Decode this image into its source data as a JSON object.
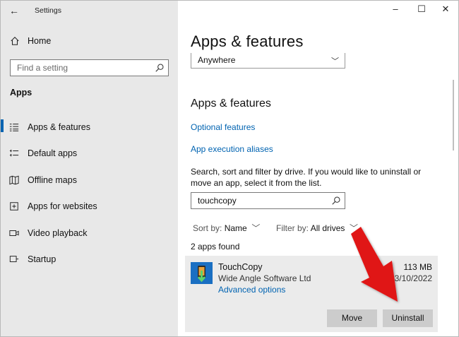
{
  "window": {
    "title": "Settings"
  },
  "sidebar": {
    "home_label": "Home",
    "search_placeholder": "Find a setting",
    "section_label": "Apps",
    "items": [
      {
        "label": "Apps & features",
        "icon": "apps-features-icon",
        "active": true
      },
      {
        "label": "Default apps",
        "icon": "default-apps-icon"
      },
      {
        "label": "Offline maps",
        "icon": "offline-maps-icon"
      },
      {
        "label": "Apps for websites",
        "icon": "apps-for-websites-icon"
      },
      {
        "label": "Video playback",
        "icon": "video-playback-icon"
      },
      {
        "label": "Startup",
        "icon": "startup-icon"
      }
    ]
  },
  "main": {
    "page_title": "Apps & features",
    "install_source_value": "Anywhere",
    "section_title": "Apps & features",
    "optional_features_link": "Optional features",
    "execution_aliases_link": "App execution aliases",
    "description": "Search, sort and filter by drive. If you would like to uninstall or move an app, select it from the list.",
    "search_value": "touchcopy",
    "sort_label": "Sort by:",
    "sort_value": "Name",
    "filter_label": "Filter by:",
    "filter_value": "All drives",
    "apps_found": "2 apps found",
    "app": {
      "name": "TouchCopy",
      "publisher": "Wide Angle Software Ltd",
      "advanced_options": "Advanced options",
      "size": "113 MB",
      "date": "3/10/2022",
      "move_label": "Move",
      "uninstall_label": "Uninstall"
    }
  },
  "colors": {
    "accent": "#0063b1",
    "sidebar_bg": "#e8e8e8",
    "card_bg": "#ebebeb",
    "button_bg": "#cccccc",
    "annotation_arrow": "#e01414"
  }
}
